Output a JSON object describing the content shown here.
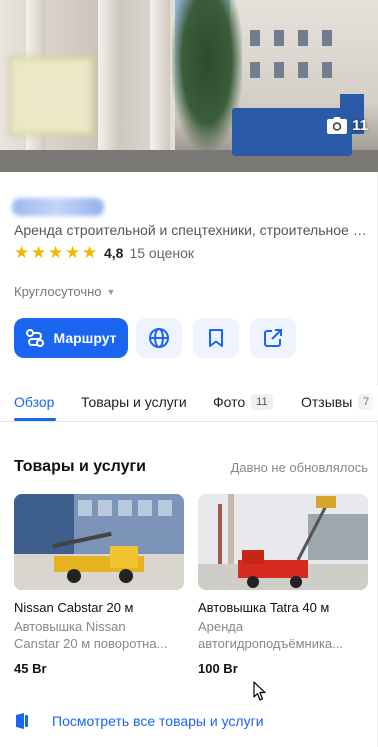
{
  "hero": {
    "photo_count": "11"
  },
  "place": {
    "category": "Аренда строительной и спецтехники, строительное оборудование",
    "rating": "4,8",
    "rating_count": "15 оценок",
    "stars": 5,
    "hours": "Круглосуточно"
  },
  "actions": {
    "route_label": "Маршрут"
  },
  "tabs": [
    {
      "label": "Обзор",
      "active": true
    },
    {
      "label": "Товары и услуги"
    },
    {
      "label": "Фото",
      "badge": "11"
    },
    {
      "label": "Отзывы",
      "badge": "7"
    }
  ],
  "goods": {
    "title": "Товары и услуги",
    "note": "Давно не обновлялось",
    "items": [
      {
        "title": "Nissan Cabstar 20 м",
        "desc_1": "Автовышка Nissan",
        "desc_2": "Canstar 20 м поворотна...",
        "price": "45 Br"
      },
      {
        "title": "Автовышка Tatra 40 м",
        "desc_1": "Аренда",
        "desc_2": "автогидроподъёмника...",
        "price": "100 Br"
      }
    ],
    "see_all": "Посмотреть все товары и услуги"
  },
  "colors": {
    "accent": "#1a66f0",
    "star": "#f7b500"
  }
}
